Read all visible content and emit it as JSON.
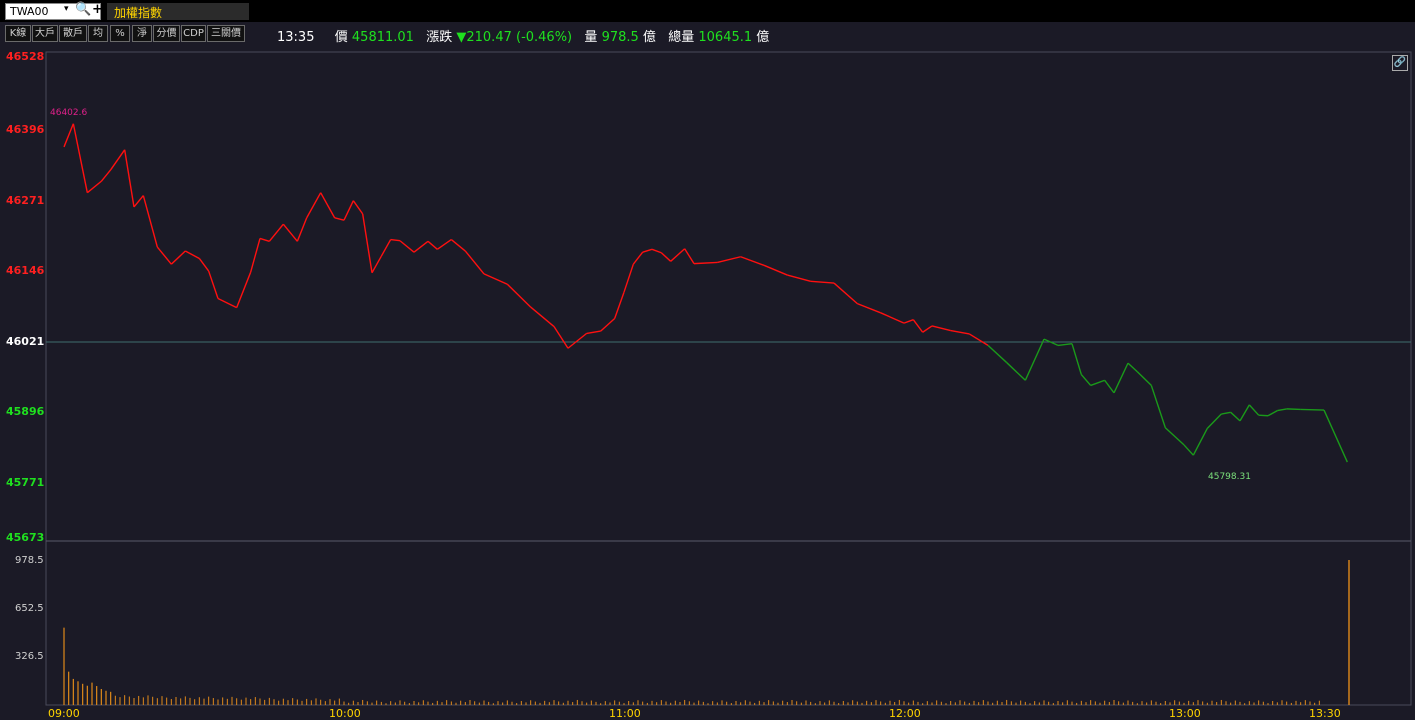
{
  "header": {
    "symbol": "TWA00",
    "dropdown_glyph": "▾",
    "search_glyph": "🔍",
    "add_glyph": "+",
    "name": "加權指數"
  },
  "toolbar": {
    "buttons": [
      "K線",
      "大戶",
      "散戶",
      "均",
      "%",
      "淨",
      "分價",
      "CDP",
      "三關價"
    ]
  },
  "quote": {
    "time": "13:35",
    "price_label": "價",
    "price": "45811.01",
    "change_label": "漲跌",
    "change": "▼210.47 (-0.46%)",
    "volume_label": "量",
    "volume": "978.5",
    "volume_unit": "億",
    "total_label": "總量",
    "total": "10645.1",
    "total_unit": "億"
  },
  "colors": {
    "up": "#ff1010",
    "down": "#1fe01f",
    "ref": "#ffffff",
    "volume": "#e08a1a",
    "background": "#1b1a26",
    "time_axis": "#ffd400"
  },
  "chart_data": {
    "type": "line",
    "title": "",
    "reference": 46021,
    "ylim": [
      45673,
      46528
    ],
    "y_ticks": [
      "46528",
      "46396",
      "46271",
      "46146",
      "46021",
      "45896",
      "45771",
      "45673"
    ],
    "x_ticks": [
      "09:00",
      "10:00",
      "11:00",
      "12:00",
      "13:00",
      "13:30"
    ],
    "x": [
      "09:00",
      "09:02",
      "09:05",
      "09:08",
      "09:10",
      "09:13",
      "09:15",
      "09:17",
      "09:20",
      "09:23",
      "09:26",
      "09:29",
      "09:31",
      "09:33",
      "09:37",
      "09:40",
      "09:42",
      "09:44",
      "09:47",
      "09:50",
      "09:52",
      "09:55",
      "09:58",
      "10:00",
      "10:02",
      "10:04",
      "10:06",
      "10:08",
      "10:10",
      "10:12",
      "10:15",
      "10:18",
      "10:20",
      "10:23",
      "10:26",
      "10:30",
      "10:35",
      "10:40",
      "10:45",
      "10:48",
      "10:52",
      "10:55",
      "10:58",
      "11:00",
      "11:02",
      "11:04",
      "11:06",
      "11:08",
      "11:10",
      "11:13",
      "11:15",
      "11:20",
      "11:25",
      "11:30",
      "11:35",
      "11:40",
      "11:45",
      "11:50",
      "11:55",
      "12:00",
      "12:02",
      "12:04",
      "12:06",
      "12:10",
      "12:14",
      "12:18",
      "12:22",
      "12:26",
      "12:30",
      "12:33",
      "12:36",
      "12:38",
      "12:40",
      "12:43",
      "12:45",
      "12:48",
      "12:50",
      "12:53",
      "12:56",
      "13:00",
      "13:02",
      "13:05",
      "13:08",
      "13:10",
      "13:12",
      "13:14",
      "13:16",
      "13:18",
      "13:20",
      "13:22",
      "13:25",
      "13:30",
      "13:35"
    ],
    "values": [
      46362,
      46402.6,
      46282,
      46302,
      46322,
      46357,
      46257,
      46277,
      46187,
      46157,
      46180,
      46167,
      46145,
      46097,
      46081,
      46143,
      46202,
      46197,
      46227,
      46197,
      46238,
      46282,
      46238,
      46234,
      46268,
      46245,
      46142,
      46171,
      46200,
      46198,
      46178,
      46197,
      46183,
      46200,
      46180,
      46140,
      46122,
      46082,
      46048,
      46010,
      46036,
      46040,
      46062,
      46108,
      46157,
      46178,
      46183,
      46177,
      46162,
      46184,
      46158,
      46160,
      46170,
      46155,
      46138,
      46127,
      46124,
      46088,
      46072,
      46054,
      46060,
      46038,
      46049,
      46041,
      46035,
      46015,
      45985,
      45954,
      46026,
      46015,
      46018,
      45964,
      45945,
      45954,
      45932,
      45984,
      45969,
      45945,
      45871,
      45841,
      45823,
      45870,
      45895,
      45898,
      45883,
      45911,
      45893,
      45892,
      45901,
      45904,
      45903,
      45902,
      45811.01
    ],
    "annotations": {
      "high": "46402.6",
      "low": "45798.31"
    },
    "volume": {
      "ylim": [
        0,
        978.5
      ],
      "y_ticks": [
        "978.5",
        "652.5",
        "326.5"
      ],
      "open_bars": [
        522,
        225,
        176,
        160,
        143,
        130,
        151,
        128,
        108,
        96,
        89
      ],
      "close_bar": 978.5
    }
  }
}
